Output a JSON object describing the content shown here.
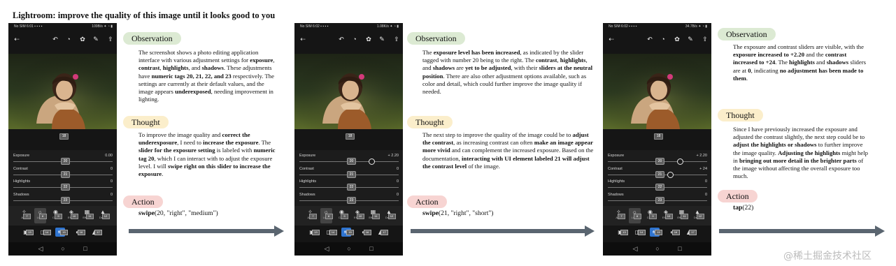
{
  "title": "Lightroom: improve the quality of this image until it looks good to you",
  "screens": [
    {
      "status": {
        "left": "No SIM 6:01 ▪ ▪ ▪ ▪",
        "right": "109B/s ✦ ◔ ▮"
      },
      "photo_tag": "18",
      "sliders": [
        {
          "label": "Exposure",
          "value": "0.00",
          "tag": "20",
          "level": 0.5
        },
        {
          "label": "Contrast",
          "value": "0",
          "tag": "21",
          "level": 0.5
        },
        {
          "label": "Highlights",
          "value": "0",
          "tag": "22",
          "level": 0.5
        },
        {
          "label": "Shadows",
          "value": "0",
          "tag": "23",
          "level": 0.5
        }
      ],
      "tabs": [
        {
          "label": "Auto",
          "tag": "7"
        },
        {
          "label": "Light",
          "tag": "8"
        },
        {
          "label": "Color",
          "tag": "9"
        },
        {
          "label": "Effect",
          "tag": "10"
        },
        {
          "label": "Effects",
          "tag": "11"
        },
        {
          "label": "Detail",
          "tag": "12"
        }
      ],
      "bottom_tags": [
        "13",
        "14",
        "15",
        "16",
        "17"
      ]
    },
    {
      "status": {
        "left": "No SIM 6:02 ▪ ▪ ▪ ▪",
        "right": "1.08K/s ✦ ◔ ▮"
      },
      "photo_tag": "18",
      "sliders": [
        {
          "label": "Exposure",
          "value": "+ 2.20",
          "tag": "20",
          "level": 0.72
        },
        {
          "label": "Contrast",
          "value": "0",
          "tag": "21",
          "level": 0.5
        },
        {
          "label": "Highlights",
          "value": "0",
          "tag": "22",
          "level": 0.5
        },
        {
          "label": "Shadows",
          "value": "0",
          "tag": "23",
          "level": 0.5
        }
      ],
      "tabs": [
        {
          "label": "Auto",
          "tag": "7"
        },
        {
          "label": "Light",
          "tag": "8"
        },
        {
          "label": "Color",
          "tag": "9"
        },
        {
          "label": "Effect",
          "tag": "10"
        },
        {
          "label": "Effects",
          "tag": "11"
        },
        {
          "label": "Detail",
          "tag": "12"
        }
      ],
      "bottom_tags": [
        "13",
        "14",
        "15",
        "16",
        "17"
      ]
    },
    {
      "status": {
        "left": "No SIM 6:02 ▪ ▪ ▪ ▪",
        "right": "34.7B/s ✦ ◔ ▮"
      },
      "photo_tag": "18",
      "sliders": [
        {
          "label": "Exposure",
          "value": "+ 2.20",
          "tag": "20",
          "level": 0.72
        },
        {
          "label": "Contrast",
          "value": "+ 24",
          "tag": "21",
          "level": 0.62
        },
        {
          "label": "Highlights",
          "value": "0",
          "tag": "22",
          "level": 0.5
        },
        {
          "label": "Shadows",
          "value": "0",
          "tag": "23",
          "level": 0.5
        }
      ],
      "tabs": [
        {
          "label": "Auto",
          "tag": "7"
        },
        {
          "label": "Light",
          "tag": "8"
        },
        {
          "label": "Color",
          "tag": "9"
        },
        {
          "label": "Effect",
          "tag": "10"
        },
        {
          "label": "Effects",
          "tag": "11"
        },
        {
          "label": "Detail",
          "tag": "12"
        }
      ],
      "bottom_tags": [
        "13",
        "14",
        "15",
        "16",
        "17"
      ]
    }
  ],
  "labels": {
    "observation": "Observation",
    "thought": "Thought",
    "action": "Action"
  },
  "steps": [
    {
      "observation": "The screenshot shows a photo editing application interface with various adjustment settings for <b>exposure</b>, <b>contrast</b>, <b>highlights</b>, and <b>shadows</b>. These adjustments have <b>numeric tags 20, 21, 22, and 23</b> respectively. The settings are currently at their default values, and the image appears <b>underexposed</b>, needing improvement in lighting.",
      "thought": "To improve the image quality and <b>correct the underexposure</b>, I need to <b>increase the exposure</b>. The <b>slider for the exposure setting</b> is labeled with <b>numeric tag 20</b>, which I can interact with to adjust the exposure level. I will <b>swipe right on this slider to increase the exposure</b>.",
      "action": "<b>swipe</b>(20, \"right\", \"medium\")"
    },
    {
      "observation": "The <b>exposure level has been increased</b>, as indicated by the slider tagged with number 20 being to the right. The <b>contrast</b>, <b>highlights</b>, and <b>shadows</b> are <b>yet to be adjusted</b>, with their <b>sliders at the neutral position</b>. There are also other adjustment options available, such as color and detail, which could further improve the image quality if needed.",
      "thought": "The next step to improve the quality of the image could be to <b>adjust the contrast</b>, as increasing contrast can often <b>make an image appear more vivid</b> and can complement the increased exposure. Based on the documentation, <b>interacting with UI element labeled 21 will adjust the contrast level</b> of the image.",
      "action": "<b>swipe</b>(21, \"right\", \"short\")"
    },
    {
      "observation": "The exposure and contrast sliders are visible, with the <b>exposure increased to +2.20</b> and the <b>contrast increased to +24</b>. The <b>highlights</b> and <b>shadows</b> sliders are at <b>0</b>, indicating <b>no adjustment has been made to them</b>.",
      "thought": "Since I have previously increased the exposure and adjusted the contrast slightly, the next step could be to <b>adjust the highlights or shadows</b> to further improve the image quality. <b>Adjusting the highlights</b> might help in <b>bringing out more detail in the brighter parts</b> of the image without affecting the overall exposure too much.",
      "action": "<b>tap</b>(22)"
    }
  ],
  "watermark": "@稀土掘金技术社区"
}
